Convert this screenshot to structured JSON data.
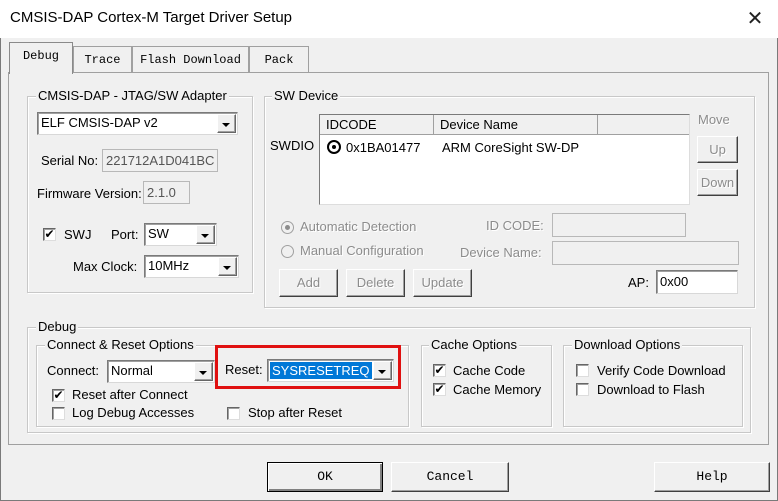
{
  "window": {
    "title": "CMSIS-DAP Cortex-M Target Driver Setup",
    "close_glyph": "✕"
  },
  "tabs": [
    "Debug",
    "Trace",
    "Flash Download",
    "Pack"
  ],
  "adapter": {
    "legend": "CMSIS-DAP - JTAG/SW Adapter",
    "selected": "ELF CMSIS-DAP v2",
    "serial_label": "Serial No:",
    "serial_value": "221712A1D041BC",
    "firmware_label": "Firmware Version:",
    "firmware_value": "2.1.0",
    "swj_label": "SWJ",
    "swj_checked": "✔",
    "port_label": "Port:",
    "port_value": "SW",
    "maxclock_label": "Max Clock:",
    "maxclock_value": "10MHz"
  },
  "sw_device": {
    "legend": "SW Device",
    "row_label": "SWDIO",
    "columns": [
      "IDCODE",
      "Device Name"
    ],
    "rows": [
      {
        "idcode": "0x1BA01477",
        "name": "ARM CoreSight SW-DP"
      }
    ],
    "move_label": "Move",
    "up_label": "Up",
    "down_label": "Down",
    "auto_detect": "Automatic Detection",
    "manual_config": "Manual Configuration",
    "idcode_label": "ID CODE:",
    "devname_label": "Device Name:",
    "add_label": "Add",
    "delete_label": "Delete",
    "update_label": "Update",
    "ap_label": "AP:",
    "ap_value": "0x00"
  },
  "debug": {
    "legend": "Debug",
    "connect_reset": {
      "legend": "Connect & Reset Options",
      "connect_label": "Connect:",
      "connect_value": "Normal",
      "reset_label": "Reset:",
      "reset_value": "SYSRESETREQ",
      "reset_after_connect": "Reset after Connect",
      "log_debug": "Log Debug Accesses",
      "stop_after_reset": "Stop after Reset"
    },
    "cache": {
      "legend": "Cache Options",
      "cache_code": "Cache Code",
      "cache_memory": "Cache Memory"
    },
    "download": {
      "legend": "Download Options",
      "verify": "Verify Code Download",
      "download_flash": "Download to Flash"
    }
  },
  "buttons": {
    "ok": "OK",
    "cancel": "Cancel",
    "help": "Help"
  },
  "colors": {
    "highlight": "#e01010",
    "selection": "#0078d7"
  }
}
